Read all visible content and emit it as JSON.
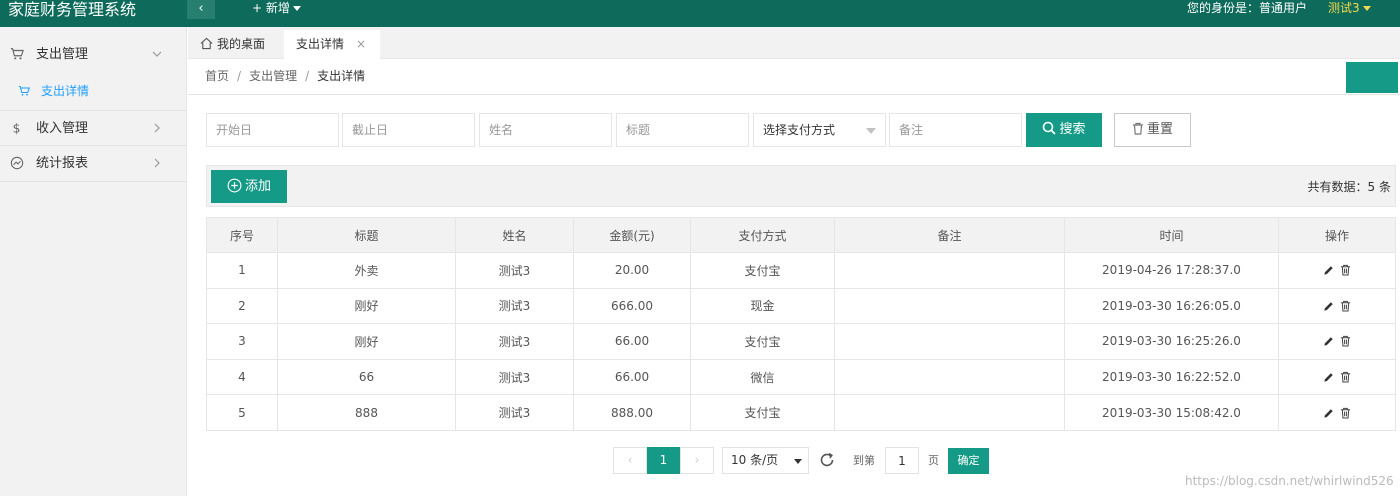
{
  "app": {
    "title": "家庭财务管理系统",
    "collapse_icon": "chevron-left-icon",
    "new_label": "+ 新增",
    "identity_label": "您的身份是：普通用户",
    "username": "测试3"
  },
  "sidebar": {
    "items": [
      {
        "label": "支出管理",
        "icon": "cart-icon"
      },
      {
        "label": "收入管理",
        "icon": "dollar-icon"
      },
      {
        "label": "统计报表",
        "icon": "chart-icon"
      }
    ],
    "sub_items": [
      {
        "label": "支出详情",
        "icon": "cart-icon"
      }
    ]
  },
  "tabs": {
    "home": "我的桌面",
    "active": "支出详情",
    "close": "×"
  },
  "breadcrumb": {
    "home": "首页",
    "section": "支出管理",
    "current": "支出详情",
    "separator": "/"
  },
  "search": {
    "start_date_placeholder": "开始日",
    "end_date_placeholder": "截止日",
    "name_placeholder": "姓名",
    "title_placeholder": "标题",
    "pay_method_selected": "选择支付方式",
    "note_placeholder": "备注",
    "search_label": "搜索",
    "reset_label": "重置"
  },
  "toolbar": {
    "add_label": "添加",
    "total_label": "共有数据：5 条"
  },
  "table": {
    "columns": [
      "序号",
      "标题",
      "姓名",
      "金额(元)",
      "支付方式",
      "备注",
      "时间",
      "操作"
    ],
    "rows": [
      {
        "id": "1",
        "title": "外卖",
        "name": "测试3",
        "amount": "20.00",
        "method": "支付宝",
        "note": "",
        "time": "2019-04-26 17:28:37.0"
      },
      {
        "id": "2",
        "title": "刚好",
        "name": "测试3",
        "amount": "666.00",
        "method": "现金",
        "note": "",
        "time": "2019-03-30 16:26:05.0"
      },
      {
        "id": "3",
        "title": "刚好",
        "name": "测试3",
        "amount": "66.00",
        "method": "支付宝",
        "note": "",
        "time": "2019-03-30 16:25:26.0"
      },
      {
        "id": "4",
        "title": "66",
        "name": "测试3",
        "amount": "66.00",
        "method": "微信",
        "note": "",
        "time": "2019-03-30 16:22:52.0"
      },
      {
        "id": "5",
        "title": "888",
        "name": "测试3",
        "amount": "888.00",
        "method": "支付宝",
        "note": "",
        "time": "2019-03-30 15:08:42.0"
      }
    ]
  },
  "pagination": {
    "prev": "‹",
    "current_page": "1",
    "next": "›",
    "page_size": "10 条/页",
    "goto_label": "到第",
    "goto_value": "1",
    "page_label": "页",
    "confirm_label": "确定"
  },
  "watermark": "https://blog.csdn.net/whirlwind526",
  "colors": {
    "header": "#0e6b5b",
    "accent": "#149a86",
    "username": "#f2d94e",
    "link": "#1e9fff"
  }
}
